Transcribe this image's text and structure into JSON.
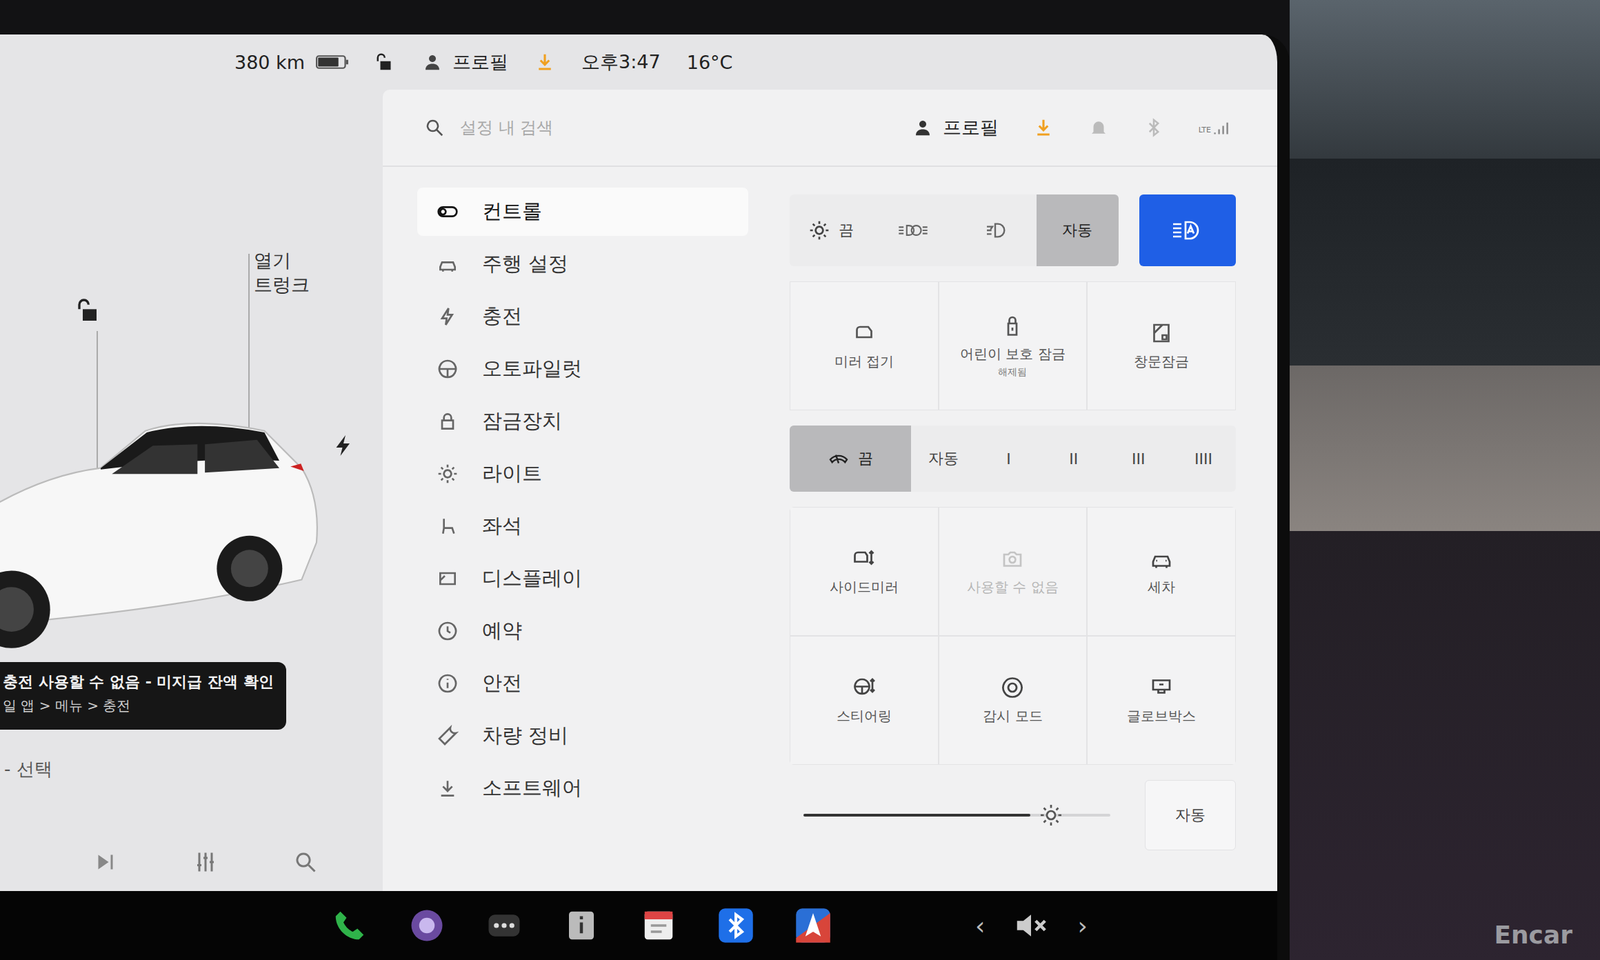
{
  "status_bar": {
    "range": "380 km",
    "battery_level": 0.8,
    "locked": false,
    "profile": "프로필",
    "update_available": true,
    "time": "오후3:47",
    "temperature": "16°C"
  },
  "car_panel": {
    "trunk_action": "열기",
    "trunk_label": "트렁크",
    "charge_port_open": true,
    "notice": {
      "title": "충전 사용할 수 없음 - 미지급 잔액 확인",
      "subtitle": "일 앱 > 메뉴 > 충전"
    },
    "source_hint": "- 선택"
  },
  "settings": {
    "search": {
      "placeholder": "설정 내 검색"
    },
    "profile": "프로필",
    "network": "LTE"
  },
  "sidebar": {
    "items": [
      {
        "label": "컨트롤",
        "selected": true
      },
      {
        "label": "주행 설정",
        "selected": false
      },
      {
        "label": "충전",
        "selected": false
      },
      {
        "label": "오토파일럿",
        "selected": false
      },
      {
        "label": "잠금장치",
        "selected": false
      },
      {
        "label": "라이트",
        "selected": false
      },
      {
        "label": "좌석",
        "selected": false
      },
      {
        "label": "디스플레이",
        "selected": false
      },
      {
        "label": "예약",
        "selected": false
      },
      {
        "label": "안전",
        "selected": false
      },
      {
        "label": "차량 정비",
        "selected": false
      },
      {
        "label": "소프트웨어",
        "selected": false
      }
    ]
  },
  "headlights": {
    "options": [
      {
        "kind": "off",
        "label": "끔",
        "selected": false
      },
      {
        "kind": "parking",
        "selected": false
      },
      {
        "kind": "low-beam",
        "selected": false
      },
      {
        "kind": "auto",
        "label": "자동",
        "selected": true
      }
    ],
    "auto_high_beam_on": true
  },
  "tiles_top": [
    {
      "kind": "mirror-fold",
      "label": "미러 접기",
      "disabled": false
    },
    {
      "kind": "child-lock",
      "label": "어린이 보호 잠금",
      "sub": "해제됨",
      "disabled": false
    },
    {
      "kind": "window-lock",
      "label": "창문잠금",
      "disabled": false
    }
  ],
  "wipers": {
    "options": [
      {
        "kind": "off",
        "label": "끔",
        "selected": true
      },
      {
        "kind": "text",
        "label": "자동",
        "selected": false
      },
      {
        "kind": "text",
        "label": "I",
        "selected": false
      },
      {
        "kind": "text",
        "label": "II",
        "selected": false
      },
      {
        "kind": "text",
        "label": "III",
        "selected": false
      },
      {
        "kind": "text",
        "label": "IIII",
        "selected": false
      }
    ]
  },
  "tiles_bottom": [
    {
      "kind": "side-mirror",
      "label": "사이드미러",
      "disabled": false
    },
    {
      "kind": "camera",
      "label": "사용할 수 없음",
      "disabled": true
    },
    {
      "kind": "car-wash",
      "label": "세차",
      "disabled": false
    },
    {
      "kind": "steering",
      "label": "스티어링",
      "disabled": false
    },
    {
      "kind": "sentry",
      "label": "감시 모드",
      "disabled": false
    },
    {
      "kind": "glovebox",
      "label": "글로브박스",
      "disabled": false
    }
  ],
  "brightness": {
    "level": 0.74,
    "auto_label": "자동",
    "auto_on": false
  },
  "taskbar": {
    "volume_muted": true,
    "prev": "‹",
    "next": "›"
  },
  "watermark": "Encar"
}
